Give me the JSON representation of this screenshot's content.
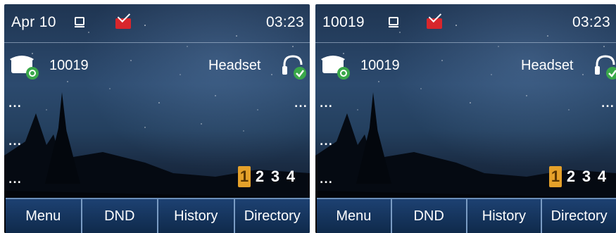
{
  "screens": [
    {
      "status": {
        "date": "Apr 10",
        "time": "03:23"
      },
      "line": {
        "number": "10019",
        "audio_mode": "Headset"
      },
      "indicators": [
        "...",
        "...",
        "...",
        "..."
      ],
      "pages": [
        "1",
        "2",
        "3",
        "4"
      ],
      "active_page": "1",
      "softkeys": [
        "Menu",
        "DND",
        "History",
        "Directory"
      ]
    },
    {
      "status": {
        "date": "10019",
        "time": "03:23"
      },
      "line": {
        "number": "10019",
        "audio_mode": "Headset"
      },
      "indicators": [
        "...",
        "...",
        "...",
        "..."
      ],
      "pages": [
        "1",
        "2",
        "3",
        "4"
      ],
      "active_page": "1",
      "softkeys": [
        "Menu",
        "DND",
        "History",
        "Directory"
      ]
    }
  ],
  "icons": {
    "network": "network-icon",
    "mail": "voicemail-icon",
    "phone": "desk-phone-icon",
    "headset": "headset-icon",
    "registered_badge": "check-badge-icon"
  },
  "colors": {
    "softkey_bg": "#102b4d",
    "softkey_border": "#7a9cc4",
    "active_page": "#e5a12a",
    "mail_red": "#d8262c",
    "status_green": "#3aa84a"
  }
}
